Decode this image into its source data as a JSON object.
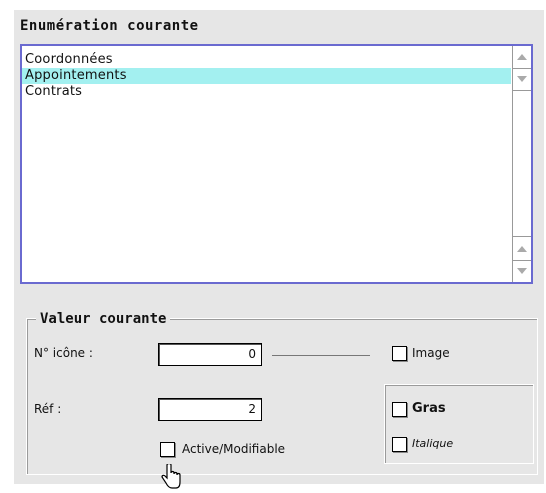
{
  "enumeration": {
    "title": "Enumération courante",
    "items": [
      {
        "label": "Coordonnées",
        "selected": false
      },
      {
        "label": "Appointements",
        "selected": true
      },
      {
        "label": "Contrats",
        "selected": false
      }
    ]
  },
  "current_value": {
    "title": "Valeur courante",
    "icon_number_label": "N° icône :",
    "icon_number_value": "0",
    "ref_label": "Réf :",
    "ref_value": "2",
    "image_label": "Image",
    "bold_label": "Gras",
    "italic_label": "Italique",
    "active_label": "Active/Modifiable"
  },
  "colors": {
    "panel_bg": "#e6e6e6",
    "selection": "#a3f0f0",
    "list_border": "#6a6ad0"
  }
}
